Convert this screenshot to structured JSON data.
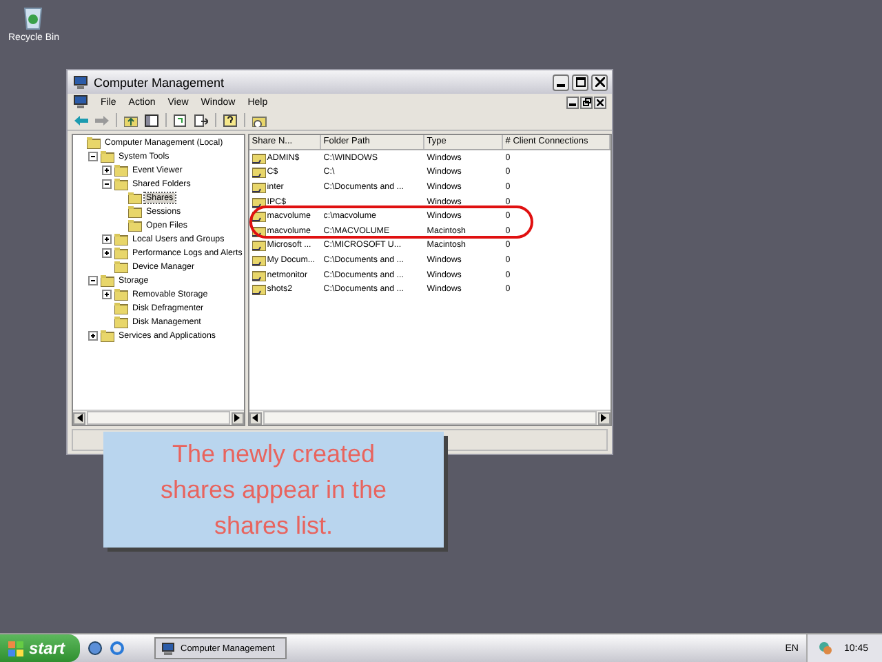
{
  "desktop_icons": [
    {
      "label": "Recycle Bin"
    }
  ],
  "window": {
    "title": "Computer Management"
  },
  "menu": [
    "File",
    "Action",
    "View",
    "Window",
    "Help"
  ],
  "tree": [
    {
      "label": "Computer Management (Local)",
      "selected": false,
      "children": [
        {
          "label": "System Tools",
          "expanded": true,
          "selected": false,
          "children": [
            {
              "label": "Event Viewer",
              "expanded": false,
              "selected": false
            },
            {
              "label": "Shared Folders",
              "expanded": true,
              "selected": false,
              "children": [
                {
                  "label": "Shares",
                  "selected": true
                },
                {
                  "label": "Sessions",
                  "selected": false
                },
                {
                  "label": "Open Files",
                  "selected": false
                }
              ]
            },
            {
              "label": "Local Users and Groups",
              "expanded": false,
              "selected": false
            },
            {
              "label": "Performance Logs and Alerts",
              "expanded": false,
              "selected": false
            },
            {
              "label": "Device Manager",
              "selected": false
            }
          ]
        },
        {
          "label": "Storage",
          "expanded": true,
          "selected": false,
          "children": [
            {
              "label": "Removable Storage",
              "expanded": false,
              "selected": false
            },
            {
              "label": "Disk Defragmenter",
              "selected": false
            },
            {
              "label": "Disk Management",
              "selected": false
            }
          ]
        },
        {
          "label": "Services and Applications",
          "expanded": false,
          "selected": false
        }
      ]
    }
  ],
  "table": {
    "columns": [
      "Share N...",
      "Folder Path",
      "Type",
      "# Client Connections"
    ],
    "rows": [
      [
        "ADMIN$",
        "C:\\WINDOWS",
        "Windows",
        "0"
      ],
      [
        "C$",
        "C:\\",
        "Windows",
        "0"
      ],
      [
        "inter",
        "C:\\Documents and ...",
        "Windows",
        "0"
      ],
      [
        "IPC$",
        "",
        "Windows",
        "0"
      ],
      [
        "macvolume",
        "c:\\macvolume",
        "Windows",
        "0"
      ],
      [
        "macvolume",
        "C:\\MACVOLUME",
        "Macintosh",
        "0"
      ],
      [
        "Microsoft ...",
        "C:\\MICROSOFT U...",
        "Macintosh",
        "0"
      ],
      [
        "My Docum...",
        "C:\\Documents and ...",
        "Windows",
        "0"
      ],
      [
        "netmonitor",
        "C:\\Documents and ...",
        "Windows",
        "0"
      ],
      [
        "shots2",
        "C:\\Documents and ...",
        "Windows",
        "0"
      ]
    ]
  },
  "callout": "The newly created shares appear in the shares list.",
  "taskbar": {
    "start": "start",
    "tasks": [
      {
        "label": "Computer Management",
        "selected": false
      }
    ],
    "language": "EN",
    "clock": "10:45"
  }
}
